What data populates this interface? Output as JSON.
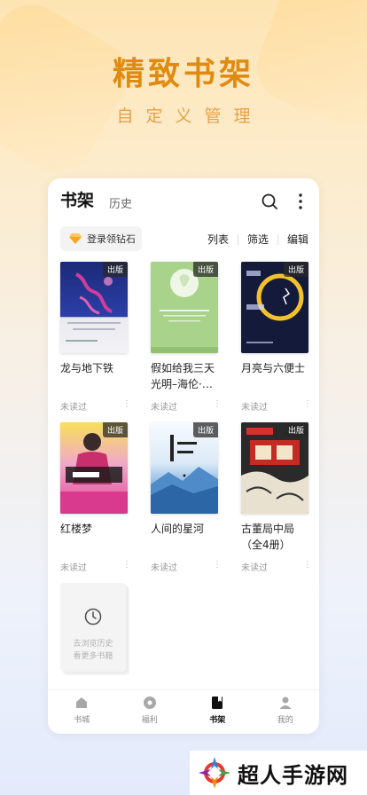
{
  "hero": {
    "title": "精致书架",
    "subtitle": "自定义管理"
  },
  "header": {
    "tab_active": "书架",
    "tab_history": "历史",
    "diamond_button": "登录领钻石",
    "actions": [
      "列表",
      "筛选",
      "编辑"
    ]
  },
  "books": [
    {
      "title": "龙与地下铁",
      "badge": "出版",
      "status": "未读过"
    },
    {
      "title": "假如给我三天光明–海伦·…",
      "badge": "出版",
      "status": "未读过"
    },
    {
      "title": "月亮与六便士",
      "badge": "出版",
      "status": "未读过"
    },
    {
      "title": "红楼梦",
      "badge": "出版",
      "status": "未读过"
    },
    {
      "title": "人间的星河",
      "badge": "出版",
      "status": "未读过"
    },
    {
      "title": "古董局中局（全4册）",
      "badge": "出版",
      "status": "未读过"
    }
  ],
  "history_card": {
    "line1": "去浏览历史",
    "line2": "看更多书籍"
  },
  "tabbar": [
    {
      "label": "书城",
      "icon": "home-icon"
    },
    {
      "label": "福利",
      "icon": "gift-icon"
    },
    {
      "label": "书架",
      "icon": "bookmark-icon",
      "active": true
    },
    {
      "label": "我的",
      "icon": "user-icon"
    }
  ],
  "watermark": {
    "text": "超人手游网"
  },
  "colors": {
    "accent": "#e08a12",
    "background_top": "#fde4b3",
    "background_bottom": "#e3eafb"
  }
}
